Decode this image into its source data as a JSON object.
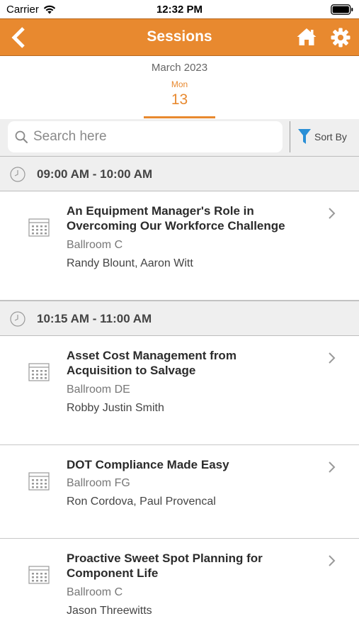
{
  "status_bar": {
    "carrier": "Carrier",
    "time": "12:32 PM"
  },
  "navbar": {
    "title": "Sessions",
    "back_icon": "chevron-left-icon",
    "home_icon": "home-icon",
    "settings_icon": "gear-icon"
  },
  "date_selector": {
    "month": "March 2023",
    "day_name": "Mon",
    "day_number": "13"
  },
  "search": {
    "placeholder": "Search here",
    "value": "",
    "sort_label": "Sort By"
  },
  "colors": {
    "accent": "#e8892f",
    "filter_icon": "#2a8fd6",
    "header_bg": "#efefef"
  },
  "groups": [
    {
      "time": "09:00 AM - 10:00 AM",
      "sessions": [
        {
          "title_line1": "An Equipment Manager's Role in",
          "title_line2": "Overcoming Our Workforce Challenge",
          "room": "Ballroom C",
          "speakers": "Randy Blount, Aaron Witt"
        }
      ]
    },
    {
      "time": "10:15 AM - 11:00 AM",
      "sessions": [
        {
          "title_line1": "Asset Cost Management from",
          "title_line2": "Acquisition to Salvage",
          "room": "Ballroom DE",
          "speakers": "Robby Justin Smith"
        },
        {
          "title_line1": "DOT Compliance Made Easy",
          "title_line2": "",
          "room": "Ballroom FG",
          "speakers": "Ron Cordova, Paul Provencal"
        },
        {
          "title_line1": "Proactive Sweet Spot Planning for",
          "title_line2": "Component Life",
          "room": "Ballroom C",
          "speakers": "Jason Threewitts"
        }
      ]
    }
  ]
}
